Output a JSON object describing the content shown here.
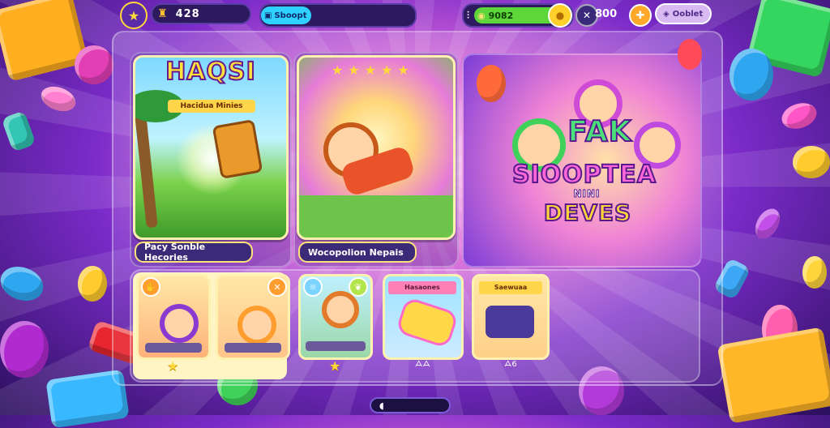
{
  "topbar": {
    "coins": "428",
    "search_label": "Sboopt",
    "gems_label": "9082",
    "energy": "800",
    "shop_label": "Ooblet",
    "icons": [
      "star-icon",
      "castle-icon",
      "search-icon",
      "gem-icon",
      "gear-icon",
      "plus-icon",
      "shop-icon"
    ]
  },
  "cards": {
    "card1": {
      "title": "HAQSI",
      "banner": "Hacidua Minies",
      "caption": "Pacy Sonble Hecories"
    },
    "card2": {
      "caption": "Wocopolion Nepais"
    },
    "card3": {
      "line1": "FAK",
      "line2": "SIOOPTEA",
      "line3": "NINI",
      "line4": "DEVES"
    }
  },
  "thumbs": [
    {
      "badge": "",
      "rating": "★"
    },
    {
      "badge": "",
      "rating": ""
    },
    {
      "badge": "",
      "rating": "★"
    },
    {
      "badge": "Hasaones",
      "rating": "ᗋᗋ"
    },
    {
      "badge": "Saewuaa",
      "rating": "ᗋ6"
    }
  ],
  "colors": {
    "accent": "#ffe27a",
    "panel_border": "#fff2b0",
    "dark_pill": "#2d1a5e",
    "green_bar": "#5dd63a"
  },
  "bottom": {
    "label": "◖"
  }
}
